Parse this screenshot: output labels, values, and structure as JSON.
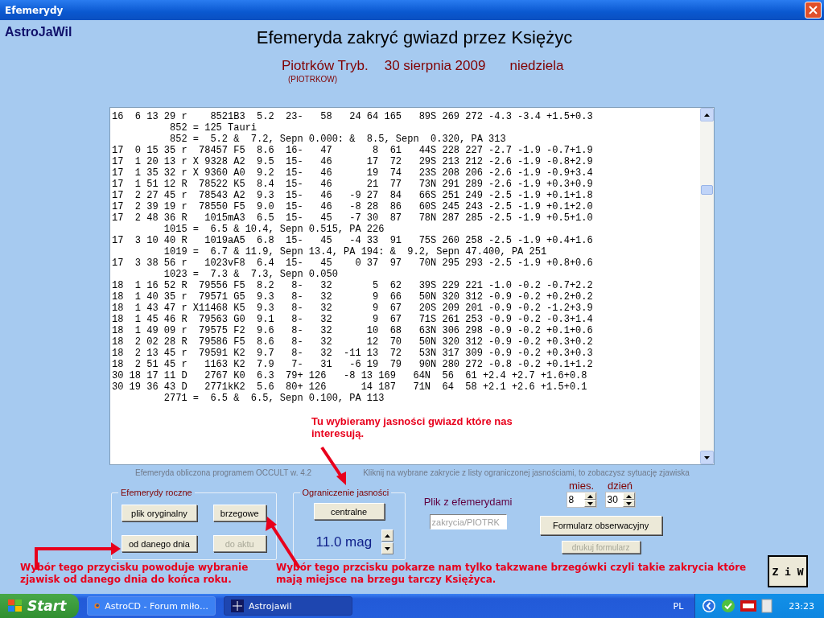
{
  "window": {
    "title": "Efemerydy"
  },
  "brand": "AstroJaWil",
  "heading": "Efemeryda zakryć gwiazd przez Księżyc",
  "location": {
    "place": "Piotrków Tryb.",
    "date": "30 sierpnia 2009",
    "weekday": "niedziela",
    "code": "(PIOTRKOW)"
  },
  "listing": {
    "lines": [
      "16  6 13 29 r    8521B3  5.2  23-   58   24 64 165   89S 269 272 -4.3 -3.4 +1.5+0.3",
      "          852 = 125 Tauri",
      "          852 =  5.2 &  7.2, Sepn 0.000: &  8.5, Sepn  0.320, PA 313",
      "17  0 15 35 r  78457 F5  8.6  16-   47       8  61   44S 228 227 -2.7 -1.9 -0.7+1.9",
      "17  1 20 13 r X 9328 A2  9.5  15-   46      17  72   29S 213 212 -2.6 -1.9 -0.8+2.9",
      "17  1 35 32 r X 9360 A0  9.2  15-   46      19  74   23S 208 206 -2.6 -1.9 -0.9+3.4",
      "17  1 51 12 R  78522 K5  8.4  15-   46      21  77   73N 291 289 -2.6 -1.9 +0.3+0.9",
      "17  2 27 45 r  78543 A2  9.3  15-   46   -9 27  84   66S 251 249 -2.5 -1.9 +0.1+1.8",
      "17  2 39 19 r  78550 F5  9.0  15-   46   -8 28  86   60S 245 243 -2.5 -1.9 +0.1+2.0",
      "17  2 48 36 R   1015mA3  6.5  15-   45   -7 30  87   78N 287 285 -2.5 -1.9 +0.5+1.0",
      "         1015 =  6.5 & 10.4, Sepn 0.515, PA 226",
      "17  3 10 40 R   1019aA5  6.8  15-   45   -4 33  91   75S 260 258 -2.5 -1.9 +0.4+1.6",
      "         1019 =  6.7 & 11.9, Sepn 13.4, PA 194: &  9.2, Sepn 47.400, PA 251",
      "17  3 38 56 r   1023vF8  6.4  15-   45    0 37  97   70N 295 293 -2.5 -1.9 +0.8+0.6",
      "         1023 =  7.3 &  7.3, Sepn 0.050",
      "18  1 16 52 R  79556 F5  8.2   8-   32       5  62   39S 229 221 -1.0 -0.2 -0.7+2.2",
      "18  1 40 35 r  79571 G5  9.3   8-   32       9  66   50N 320 312 -0.9 -0.2 +0.2+0.2",
      "18  1 43 47 r X11468 K5  9.3   8-   32       9  67   20S 209 201 -0.9 -0.2 -1.2+3.9",
      "18  1 45 46 R  79563 G0  9.1   8-   32       9  67   71S 261 253 -0.9 -0.2 -0.3+1.4",
      "18  1 49 09 r  79575 F2  9.6   8-   32      10  68   63N 306 298 -0.9 -0.2 +0.1+0.6",
      "18  2 02 28 R  79586 F5  8.6   8-   32      12  70   50N 320 312 -0.9 -0.2 +0.3+0.2",
      "18  2 13 45 r  79591 K2  9.7   8-   32  -11 13  72   53N 317 309 -0.9 -0.2 +0.3+0.3",
      "18  2 51 45 r   1163 K2  7.9   7-   31   -6 19  79   90N 280 272 -0.8 -0.2 +0.1+1.2",
      "30 18 17 11 D   2767 K0  6.3  79+ 126   -8 13 169   64N  56  61 +2.4 +2.7 +1.6+0.8",
      "30 19 36 43 D   2771kK2  5.6  80+ 126      14 187   71N  64  58 +2.1 +2.6 +1.5+0.1",
      "         2771 =  6.5 &  6.5, Sepn 0.100, PA 113"
    ]
  },
  "info": {
    "program": "Efemeryda  obliczona programem OCCULT w. 4.2",
    "hint": "Kliknij na wybrane zakrycie z listy ograniczonej jasnościami, to zobaczysz sytuację zjawiska"
  },
  "yearly_group": {
    "title": "Efemerydy roczne",
    "buttons": [
      {
        "label": "plik oryginalny",
        "disabled": false
      },
      {
        "label": "brzegowe",
        "disabled": false
      },
      {
        "label": "od danego dnia",
        "disabled": false
      },
      {
        "label": "do aktu",
        "disabled": true
      }
    ]
  },
  "brightness_group": {
    "title": "Ograniczenie jasności",
    "button": "centralne",
    "magnitude": "11.0 mag"
  },
  "ephemeris_file": {
    "label": "Plik z efemerydami",
    "value": "zakrycia/PIOTRK",
    "disabled": true
  },
  "date_pickers": [
    {
      "label": "mies.",
      "value": "8"
    },
    {
      "label": "dzień",
      "value": "30"
    }
  ],
  "form_buttons": [
    {
      "label": "Formularz obserwacyjny",
      "disabled": false
    },
    {
      "label": "drukuj formularz",
      "disabled": true
    }
  ],
  "ziw_button": "Z i W",
  "annotations": [
    {
      "text": "Tu wybieramy jasności gwiazd które nas interesują."
    },
    {
      "text": "Wybór tego przycisku powoduje wybranie zjawisk od danego dnia do końca roku."
    },
    {
      "text": "Wybór tego przcisku pokarze nam tylko takzwane brzegówki czyli takie zakrycia które mają miejsce na brzegu tarczy Księżyca."
    }
  ],
  "taskbar": {
    "start": "Start",
    "tasks": [
      {
        "label": "AstroCD - Forum miło…",
        "selected": false
      },
      {
        "label": "Astrojawil",
        "selected": true
      }
    ],
    "language": "PL",
    "clock": "23:23"
  }
}
